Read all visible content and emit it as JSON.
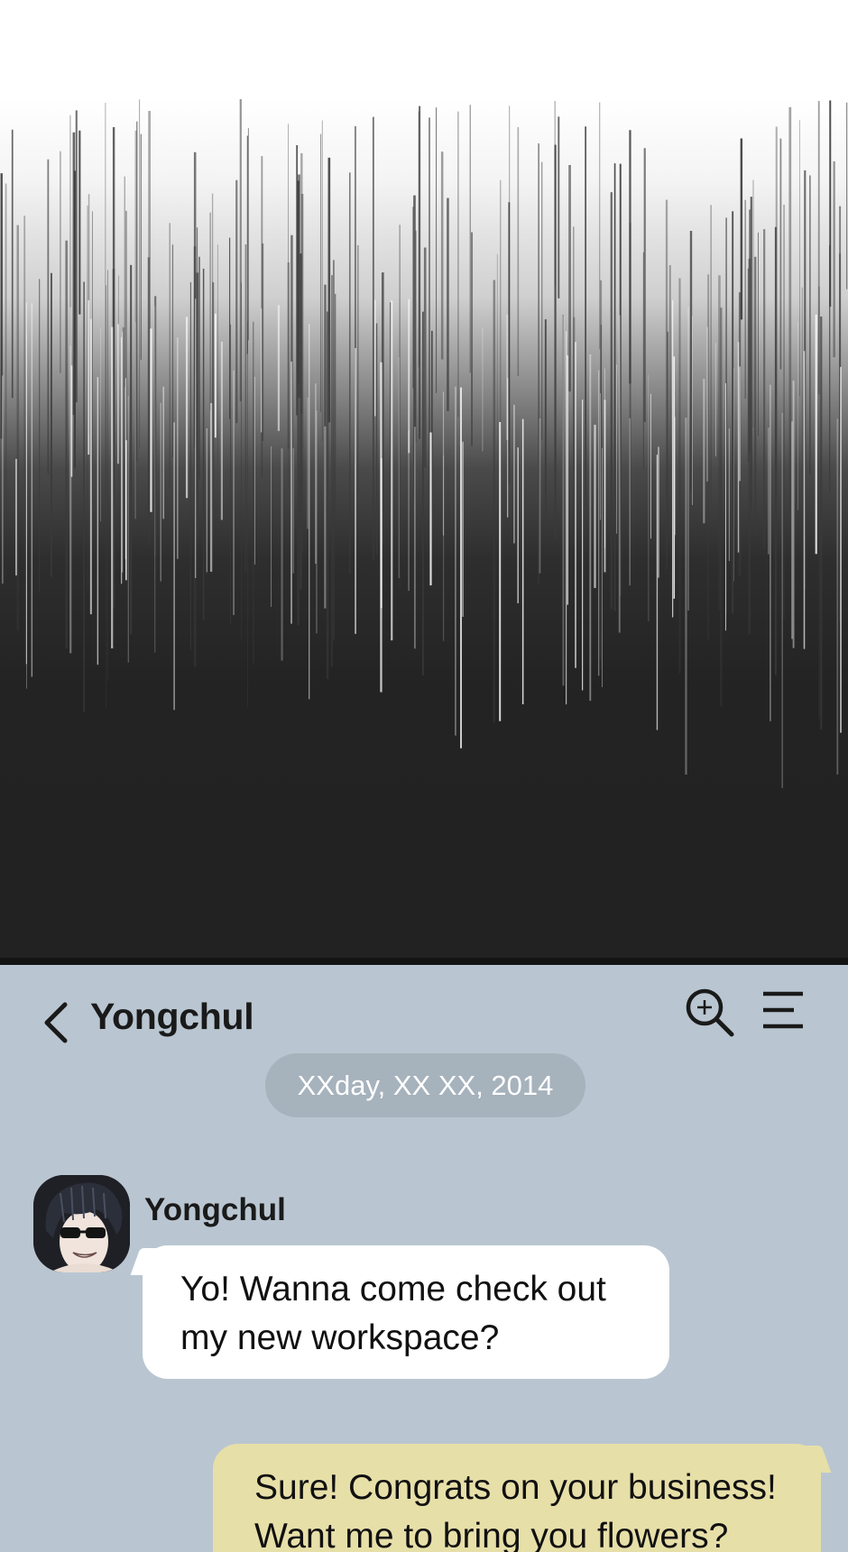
{
  "chat_header": {
    "title": "Yongchul",
    "back_icon": "chevron-left-icon",
    "search_icon": "zoom-in-search-icon",
    "menu_icon": "hamburger-menu-icon"
  },
  "date_separator": "XXday, XX XX, 2014",
  "messages": [
    {
      "direction": "incoming",
      "sender": "Yongchul",
      "lines": [
        "Yo! Wanna come check out",
        "my new workspace?"
      ]
    },
    {
      "direction": "outgoing",
      "lines": [
        "Sure! Congrats on your business!",
        "Want me to bring you flowers?"
      ]
    }
  ],
  "colors": {
    "chat_background": "#b9c6d1",
    "date_pill": "#a6b2bc",
    "incoming_bubble": "#ffffff",
    "outgoing_bubble": "#e7dfa8"
  }
}
